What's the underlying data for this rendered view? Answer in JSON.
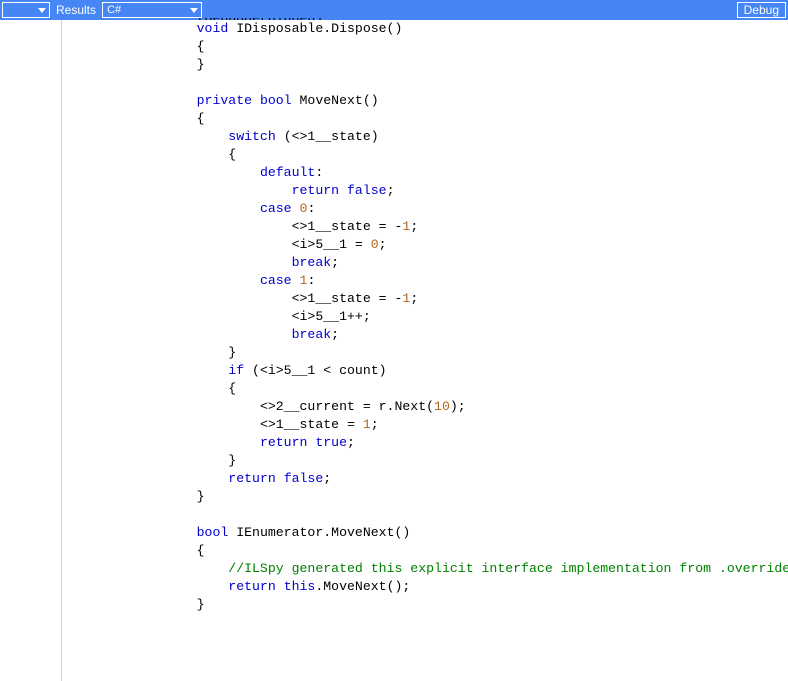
{
  "toolbar": {
    "first_dropdown": "",
    "results_label": "Results",
    "language_dropdown": "C#",
    "debug_button": "Debug"
  },
  "code": {
    "lines": [
      {
        "indent": 3,
        "tokens": [
          {
            "t": "[DebuggerHidden]",
            "c": ""
          }
        ],
        "cut": true
      },
      {
        "indent": 3,
        "tokens": [
          {
            "t": "void",
            "c": "kw"
          },
          {
            "t": " IDisposable.Dispose()"
          }
        ]
      },
      {
        "indent": 3,
        "tokens": [
          {
            "t": "{"
          }
        ]
      },
      {
        "indent": 3,
        "tokens": [
          {
            "t": "}"
          }
        ]
      },
      {
        "indent": 0,
        "tokens": [
          {
            "t": ""
          }
        ]
      },
      {
        "indent": 3,
        "tokens": [
          {
            "t": "private ",
            "c": "kw"
          },
          {
            "t": "bool ",
            "c": "kw"
          },
          {
            "t": "MoveNext()"
          }
        ]
      },
      {
        "indent": 3,
        "tokens": [
          {
            "t": "{"
          }
        ]
      },
      {
        "indent": 4,
        "tokens": [
          {
            "t": "switch ",
            "c": "kw"
          },
          {
            "t": "(<>1__state)"
          }
        ]
      },
      {
        "indent": 4,
        "tokens": [
          {
            "t": "{"
          }
        ]
      },
      {
        "indent": 5,
        "tokens": [
          {
            "t": "default",
            "c": "kw"
          },
          {
            "t": ":"
          }
        ]
      },
      {
        "indent": 6,
        "tokens": [
          {
            "t": "return ",
            "c": "kw"
          },
          {
            "t": "false",
            "c": "kw"
          },
          {
            "t": ";"
          }
        ]
      },
      {
        "indent": 5,
        "tokens": [
          {
            "t": "case ",
            "c": "kw"
          },
          {
            "t": "0",
            "c": "num"
          },
          {
            "t": ":"
          }
        ]
      },
      {
        "indent": 6,
        "tokens": [
          {
            "t": "<>1__state = -"
          },
          {
            "t": "1",
            "c": "num"
          },
          {
            "t": ";"
          }
        ]
      },
      {
        "indent": 6,
        "tokens": [
          {
            "t": "<i>5__1 = "
          },
          {
            "t": "0",
            "c": "num"
          },
          {
            "t": ";"
          }
        ]
      },
      {
        "indent": 6,
        "tokens": [
          {
            "t": "break",
            "c": "kw"
          },
          {
            "t": ";"
          }
        ]
      },
      {
        "indent": 5,
        "tokens": [
          {
            "t": "case ",
            "c": "kw"
          },
          {
            "t": "1",
            "c": "num"
          },
          {
            "t": ":"
          }
        ]
      },
      {
        "indent": 6,
        "tokens": [
          {
            "t": "<>1__state = -"
          },
          {
            "t": "1",
            "c": "num"
          },
          {
            "t": ";"
          }
        ]
      },
      {
        "indent": 6,
        "tokens": [
          {
            "t": "<i>5__1++;"
          }
        ]
      },
      {
        "indent": 6,
        "tokens": [
          {
            "t": "break",
            "c": "kw"
          },
          {
            "t": ";"
          }
        ]
      },
      {
        "indent": 4,
        "tokens": [
          {
            "t": "}"
          }
        ]
      },
      {
        "indent": 4,
        "tokens": [
          {
            "t": "if ",
            "c": "kw"
          },
          {
            "t": "(<i>5__1 < count)"
          }
        ]
      },
      {
        "indent": 4,
        "tokens": [
          {
            "t": "{"
          }
        ]
      },
      {
        "indent": 5,
        "tokens": [
          {
            "t": "<>2__current = r.Next("
          },
          {
            "t": "10",
            "c": "num"
          },
          {
            "t": ");"
          }
        ]
      },
      {
        "indent": 5,
        "tokens": [
          {
            "t": "<>1__state = "
          },
          {
            "t": "1",
            "c": "num"
          },
          {
            "t": ";"
          }
        ]
      },
      {
        "indent": 5,
        "tokens": [
          {
            "t": "return ",
            "c": "kw"
          },
          {
            "t": "true",
            "c": "kw"
          },
          {
            "t": ";"
          }
        ]
      },
      {
        "indent": 4,
        "tokens": [
          {
            "t": "}"
          }
        ]
      },
      {
        "indent": 4,
        "tokens": [
          {
            "t": "return ",
            "c": "kw"
          },
          {
            "t": "false",
            "c": "kw"
          },
          {
            "t": ";"
          }
        ]
      },
      {
        "indent": 3,
        "tokens": [
          {
            "t": "}"
          }
        ]
      },
      {
        "indent": 0,
        "tokens": [
          {
            "t": ""
          }
        ]
      },
      {
        "indent": 3,
        "tokens": [
          {
            "t": "bool ",
            "c": "kw"
          },
          {
            "t": "IEnumerator.MoveNext()"
          }
        ]
      },
      {
        "indent": 3,
        "tokens": [
          {
            "t": "{"
          }
        ]
      },
      {
        "indent": 4,
        "tokens": [
          {
            "t": "//ILSpy generated this explicit interface implementation from .override directive",
            "c": "cm"
          }
        ]
      },
      {
        "indent": 4,
        "tokens": [
          {
            "t": "return ",
            "c": "kw"
          },
          {
            "t": "this",
            "c": "kw"
          },
          {
            "t": ".MoveNext();"
          }
        ]
      },
      {
        "indent": 3,
        "tokens": [
          {
            "t": "}"
          }
        ]
      }
    ],
    "indent_unit": "    ",
    "base_prefix": "    "
  }
}
